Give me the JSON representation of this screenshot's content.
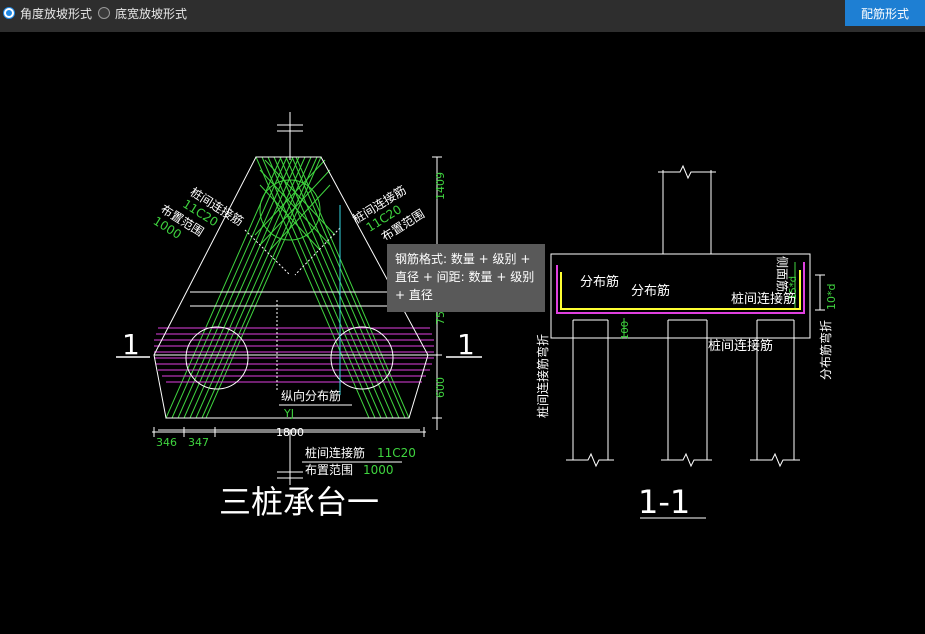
{
  "toolbar": {
    "radio_angle": "角度放坡形式",
    "radio_bottom": "底宽放坡形式",
    "config_button": "配筋形式"
  },
  "tooltip": {
    "text": "钢筋格式: 数量 + 级别 + 直径 + 间距: 数量 + 级别 + 直径"
  },
  "plan": {
    "title": "三桩承台一",
    "section_mark_left": "1",
    "section_mark_right": "1",
    "left_rebar_label": "桩间连接筋",
    "left_rebar_spec": "11C20",
    "left_range_label": "布置范围",
    "left_range_value": "1000",
    "right_rebar_label": "桩间连接筋",
    "right_rebar_spec": "11C20",
    "right_range_label": "布置范围",
    "longitudinal_label": "纵向分布筋",
    "yj_label": "YJ",
    "bottom_rebar_label": "桩间连接筋",
    "bottom_rebar_spec": "11C20",
    "bottom_range_label": "布置范围",
    "bottom_range_value": "1000",
    "dim_top": "1409",
    "dim_mid": "75",
    "dim_low": "600",
    "dim_346": "346",
    "dim_347": "347",
    "dim_1800": "1800"
  },
  "section": {
    "title": "1-1",
    "dist_rebar_1": "分布筋",
    "dist_rebar_2": "分布筋",
    "side_rebar": "侧面筋",
    "pile_conn_rebar_1": "桩间连接筋",
    "pile_conn_rebar_2": "桩间连接筋",
    "pile_conn_bend": "桩间连接筋弯折",
    "dist_bend": "分布筋弯折",
    "dim_10d": "10*d",
    "dim_100": "100",
    "dim_15d": "15*d"
  }
}
